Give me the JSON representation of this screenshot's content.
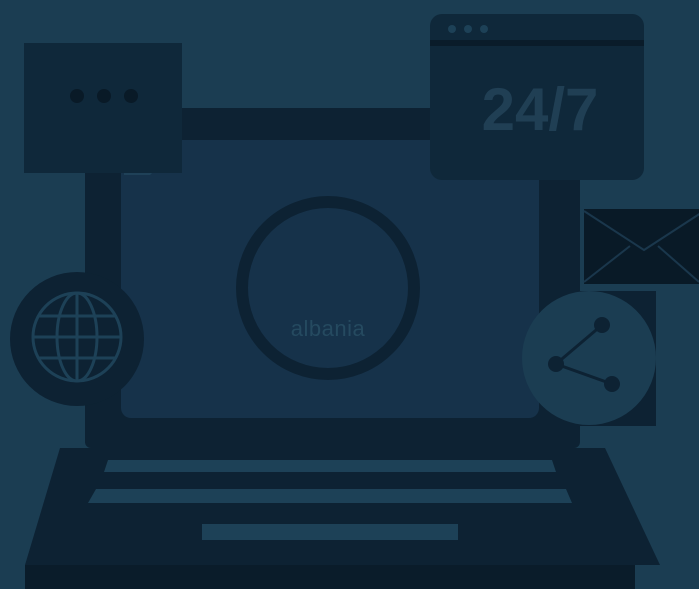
{
  "brand": {
    "label": "albania"
  },
  "support_badge": {
    "label": "24/7"
  },
  "colors": {
    "background": "#1b3d52",
    "dark": "#0d2233",
    "darker": "#091a27",
    "mid": "#16324a",
    "accent": "#254a60"
  },
  "icons": [
    "laptop-icon",
    "chat-bubble-icon",
    "browser-window-icon",
    "globe-icon",
    "email-icon",
    "share-icon",
    "sticky-note-icon"
  ]
}
